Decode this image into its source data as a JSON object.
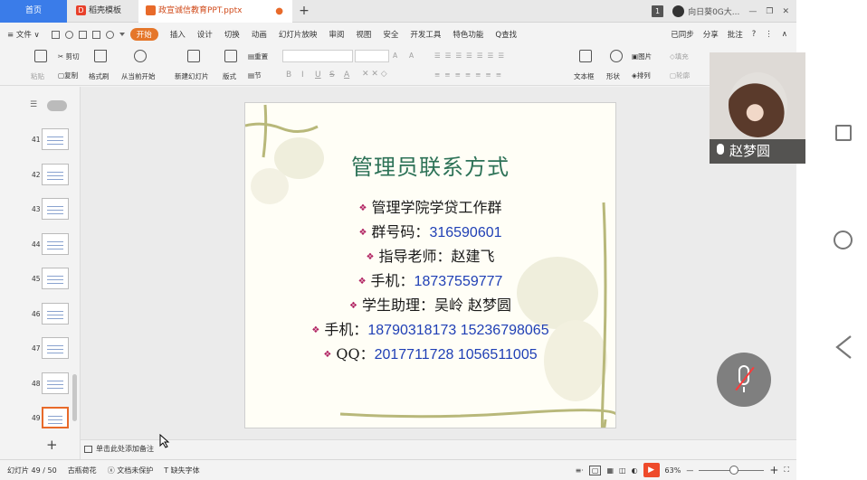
{
  "tabs": {
    "home": "首页",
    "templates": "稻壳模板",
    "document": "政宣诚信教育PPT.pptx",
    "modified_dot": "●",
    "add": "+"
  },
  "titlebar": {
    "badge": "1",
    "account": "向日葵0G大...",
    "minimize": "—",
    "restore": "❐",
    "close": "✕"
  },
  "menu": {
    "file": "≡ 文件 ∨",
    "quick_tools": [
      "保存",
      "撤销",
      "打印",
      "预览",
      "重做",
      "更多"
    ],
    "items": [
      "开始",
      "插入",
      "设计",
      "切换",
      "动画",
      "幻灯片放映",
      "审阅",
      "视图",
      "安全",
      "开发工具",
      "特色功能"
    ],
    "search": "Q查找",
    "sync": "已同步",
    "share": "分享",
    "comment": "批注",
    "help": "?",
    "more": "⋮",
    "collapse": "∧"
  },
  "ribbon": {
    "paste": "粘贴",
    "cut": "剪切",
    "copy": "复制",
    "format_painter": "格式刷",
    "from_current": "从当前开始",
    "new_slide": "新建幻灯片",
    "layout": "版式",
    "section": "节",
    "reset": "重置",
    "bold": "B",
    "italic": "I",
    "underline": "U",
    "strike": "S",
    "font_color": "A",
    "grow": "A",
    "shrink": "A",
    "textbox": "文本框",
    "shape": "形状",
    "arrange": "排列",
    "picture": "图片",
    "fill": "填充",
    "outline": "轮廓"
  },
  "thumbnails": {
    "view_icons": "☰",
    "numbers": [
      "41",
      "42",
      "43",
      "44",
      "45",
      "46",
      "47",
      "48",
      "49"
    ],
    "selected": "49"
  },
  "slide": {
    "title": "管理员联系方式",
    "lines": [
      {
        "label": "管理学院学贷工作群",
        "value": ""
      },
      {
        "label": "群号码：",
        "value": "316590601"
      },
      {
        "label": "指导老师：赵建飞",
        "value": ""
      },
      {
        "label": "手机：",
        "value": "18737559777"
      },
      {
        "label": "学生助理：吴岭  赵梦圆",
        "value": ""
      },
      {
        "label": "手机：",
        "value": "18790318173 15236798065"
      },
      {
        "label": "QQ：",
        "value": "2017711728  1056511005"
      }
    ]
  },
  "notes": {
    "placeholder": "单击此处添加备注"
  },
  "status": {
    "slide_counter": "幻灯片 49 / 50",
    "theme": "古瓶荷花",
    "protect": "文档未保护",
    "missing_font": "缺失字体",
    "zoom": "63%",
    "zoom_level": 0.63,
    "minus": "—",
    "plus": "+"
  },
  "video": {
    "participant": "赵梦圆"
  },
  "colors": {
    "accent": "#3a7ce9",
    "start_tab": "#e5762a",
    "title_green": "#2d7257",
    "number_blue": "#1f3fb5",
    "bullet": "#b02060",
    "play": "#ee4a2a"
  }
}
